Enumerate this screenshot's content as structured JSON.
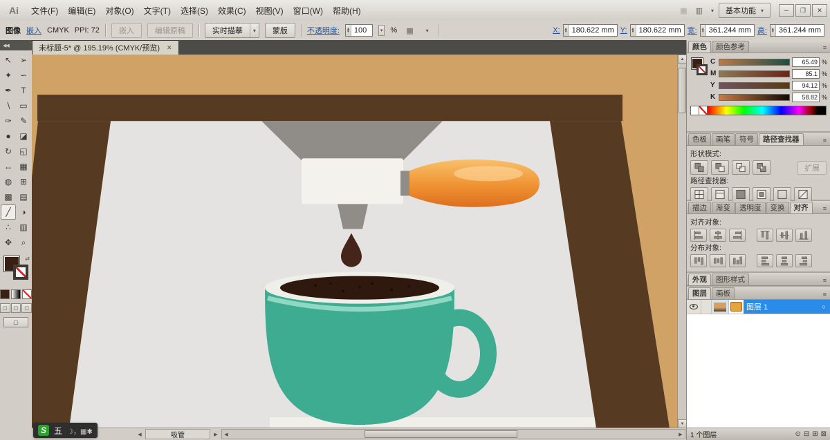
{
  "glyphs": {
    "caret_down": "▾",
    "collapse_left": "◀◀",
    "arrow_left": "◀",
    "arrow_right": "▶",
    "arrow_up": "▲",
    "arrow_down": "▼",
    "close": "✕",
    "panel_menu": "≡",
    "target_circle": "○",
    "swap": "⇄",
    "grid": "▦",
    "square": "▢",
    "arrange": "▥",
    "bridge": "▦"
  },
  "titlebar": {
    "app_logo": "Ai",
    "menus": [
      "文件(F)",
      "编辑(E)",
      "对象(O)",
      "文字(T)",
      "选择(S)",
      "效果(C)",
      "视图(V)",
      "窗口(W)",
      "帮助(H)"
    ],
    "workspace_button": "基本功能",
    "window_controls": [
      {
        "name": "minimize-button",
        "glyph": "─"
      },
      {
        "name": "restore-button",
        "glyph": "❐"
      },
      {
        "name": "close-button",
        "glyph": "✕"
      }
    ]
  },
  "controlbar": {
    "object_label": "图像",
    "embed_link": "嵌入",
    "color_mode": "CMYK",
    "ppi": "PPI: 72",
    "embed_button": "嵌入",
    "edit_original_button": "编辑原稿",
    "live_trace_button": "实时描摹",
    "mask_button": "蒙版",
    "opacity_label": "不透明度:",
    "opacity_value": "100",
    "opacity_unit": "%",
    "fields": [
      {
        "name": "x-field",
        "label": "X:",
        "value": "180.622 mm"
      },
      {
        "name": "y-field",
        "label": "Y:",
        "value": "180.622 mm"
      },
      {
        "name": "width-field",
        "label": "宽:",
        "value": "361.244 mm"
      },
      {
        "name": "height-field",
        "label": "高:",
        "value": "361.244 mm"
      }
    ]
  },
  "document": {
    "tab_title": "未标题-5* @ 195.19% (CMYK/预览)"
  },
  "tools": [
    {
      "name": "selection-tool",
      "glyph": "↖"
    },
    {
      "name": "direct-selection-tool",
      "glyph": "➢"
    },
    {
      "name": "magic-wand-tool",
      "glyph": "✦"
    },
    {
      "name": "lasso-tool",
      "glyph": "∽"
    },
    {
      "name": "pen-tool",
      "glyph": "✒"
    },
    {
      "name": "type-tool",
      "glyph": "T"
    },
    {
      "name": "line-tool",
      "glyph": "∖"
    },
    {
      "name": "rectangle-tool",
      "glyph": "▭"
    },
    {
      "name": "paintbrush-tool",
      "glyph": "✑"
    },
    {
      "name": "pencil-tool",
      "glyph": "✎"
    },
    {
      "name": "blob-brush-tool",
      "glyph": "●"
    },
    {
      "name": "eraser-tool",
      "glyph": "◪"
    },
    {
      "name": "rotate-tool",
      "glyph": "↻"
    },
    {
      "name": "scale-tool",
      "glyph": "◱"
    },
    {
      "name": "width-tool",
      "glyph": "↔"
    },
    {
      "name": "free-transform-tool",
      "glyph": "▦"
    },
    {
      "name": "shape-builder-tool",
      "glyph": "◍"
    },
    {
      "name": "perspective-grid-tool",
      "glyph": "⊞"
    },
    {
      "name": "mesh-tool",
      "glyph": "▩"
    },
    {
      "name": "gradient-tool",
      "glyph": "▤"
    },
    {
      "name": "eyedropper-tool",
      "glyph": "╱",
      "selected": true
    },
    {
      "name": "blend-tool",
      "glyph": "◑"
    },
    {
      "name": "symbol-sprayer-tool",
      "glyph": "∴"
    },
    {
      "name": "column-graph-tool",
      "glyph": "▥"
    },
    {
      "name": "hand-tool",
      "glyph": "✥"
    },
    {
      "name": "zoom-tool",
      "glyph": "⌕"
    }
  ],
  "current": {
    "fill": "#3a2012"
  },
  "panels": {
    "color": {
      "tabs": [
        "颜色",
        "颜色参考"
      ],
      "active_tab": 0,
      "channels": [
        {
          "label": "C",
          "value": "65.49"
        },
        {
          "label": "M",
          "value": "85.1"
        },
        {
          "label": "Y",
          "value": "94.12"
        },
        {
          "label": "K",
          "value": "58.82"
        }
      ],
      "unit": "%"
    },
    "pathfinder": {
      "tabs": [
        "色板",
        "画笔",
        "符号",
        "路径查找器"
      ],
      "active_tab": 3,
      "shape_mode_label": "形状模式:",
      "expand_button": "扩展",
      "pathfinder_label": "路径查找器:",
      "shape_mode_icons": [
        "unite",
        "minus-front",
        "intersect",
        "exclude"
      ],
      "pathfinder_icons": [
        "divide",
        "trim",
        "merge",
        "crop",
        "outline",
        "minus-back"
      ]
    },
    "align": {
      "tabs": [
        "描边",
        "渐变",
        "透明度",
        "变换",
        "对齐"
      ],
      "active_tab": 4,
      "align_label": "对齐对象:",
      "distribute_label": "分布对象:",
      "align_icons": [
        "align-left",
        "align-hcenter",
        "align-right",
        "align-top",
        "align-vcenter",
        "align-bottom"
      ],
      "distribute_icons": [
        "dist-top",
        "dist-vcenter",
        "dist-bottom",
        "dist-left",
        "dist-hcenter",
        "dist-right"
      ]
    },
    "appearance": {
      "tabs": [
        "外观",
        "图形样式"
      ],
      "active_tab": 0
    },
    "layers": {
      "tabs": [
        "图层",
        "画板"
      ],
      "active_tab": 0,
      "layer_name": "图层 1",
      "layer_color": "#e8a33d",
      "status": "1 个图层",
      "buttons": [
        {
          "name": "make-clip-mask-icon",
          "glyph": "⊙"
        },
        {
          "name": "new-sublayer-icon",
          "glyph": "⊟"
        },
        {
          "name": "new-layer-icon",
          "glyph": "⊞"
        },
        {
          "name": "delete-layer-icon",
          "glyph": "⊠"
        }
      ]
    }
  },
  "statusbar": {
    "tool_name": "吸管"
  },
  "ime": {
    "brand": "S",
    "mode": "五",
    "icons": [
      {
        "name": "moon-icon",
        "glyph": "☽"
      },
      {
        "name": "punctuation-icon",
        "glyph": "，"
      },
      {
        "name": "keyboard-icon",
        "glyph": "▦"
      },
      {
        "name": "settings-icon",
        "glyph": "✱"
      }
    ]
  },
  "artwork": {
    "background": "#d0a266",
    "frame": "#573a22",
    "wall": "#e4e3e1",
    "table": "#f1efe9",
    "funnel": "#908d89",
    "portafilter": "#f4f2ed",
    "handle_light": "#f8c06a",
    "handle_main": "#ef9333",
    "handle_dark": "#dd6f1d",
    "drop": "#45251a",
    "cup": "#3eac90",
    "cup_band": "#8ed8c4",
    "coffee": "#2f180d",
    "rim": "#efefe9"
  }
}
